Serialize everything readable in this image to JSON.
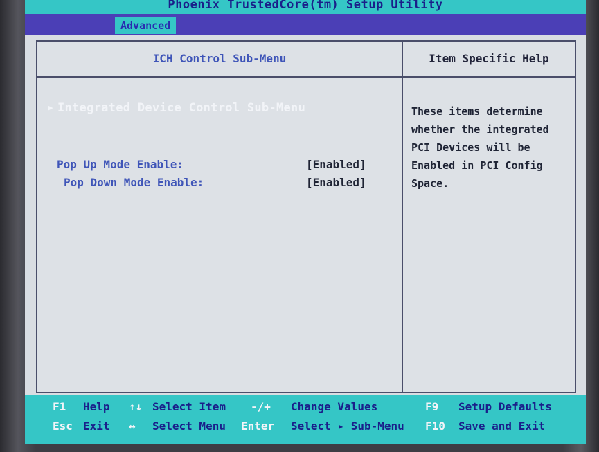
{
  "title": "Phoenix TrustedCore(tm) Setup Utility",
  "menu": {
    "active_tab": "Advanced"
  },
  "left_panel": {
    "header": "ICH Control Sub-Menu",
    "submenu_item": "Integrated Device Control Sub-Menu",
    "settings": [
      {
        "label": "Pop Up Mode Enable:",
        "value": "[Enabled]"
      },
      {
        "label": "Pop Down Mode Enable:",
        "value": "[Enabled]"
      }
    ]
  },
  "right_panel": {
    "header": "Item Specific Help",
    "help_lines": [
      "These items determine",
      "whether the integrated",
      "PCI Devices will be",
      "Enabled in PCI Config",
      "Space."
    ]
  },
  "footer": {
    "row1": [
      {
        "key": "F1",
        "label": "Help"
      },
      {
        "key": "↑↓",
        "label": "Select Item"
      },
      {
        "key": "-/+",
        "label": "Change Values"
      },
      {
        "key": "F9",
        "label": "Setup Defaults"
      }
    ],
    "row2": [
      {
        "key": "Esc",
        "label": "Exit"
      },
      {
        "key": "↔",
        "label": "Select Menu"
      },
      {
        "key": "Enter",
        "label": "Select ▸ Sub-Menu"
      },
      {
        "key": "F10",
        "label": "Save and Exit"
      }
    ]
  },
  "colors": {
    "screen_bg": "#d9dde2",
    "title_bar": "#35c6c6",
    "menu_bar": "#4b3fb6",
    "footer_bg": "#35c6c6",
    "label_blue": "#3f55b8",
    "dark_text": "#1f2435"
  }
}
